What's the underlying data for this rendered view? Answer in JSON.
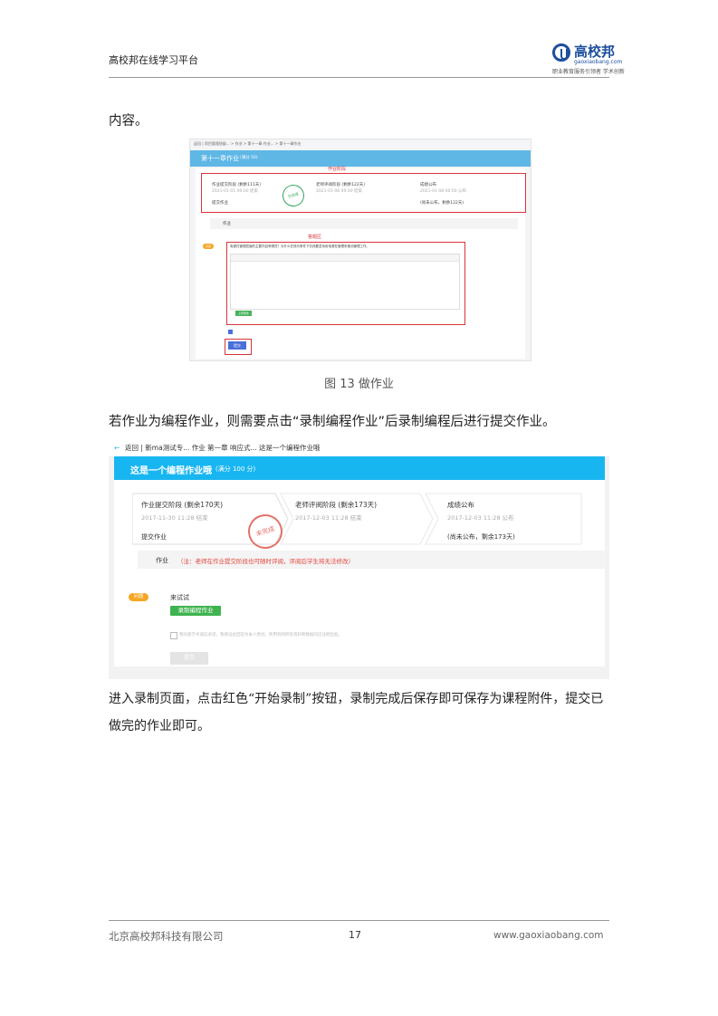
{
  "header": {
    "title": "高校邦在线学习平台",
    "logo_name": "高校邦",
    "logo_url": "gaoxiaobang.com",
    "logo_tagline": "职业教育服务引领者 学术创新"
  },
  "body": {
    "intro": "内容。",
    "figure13_caption": "图 13 做作业",
    "para_programming": "若作业为编程作业，则需要点击“录制编程作业”后录制编程后进行提交作业。",
    "para_record_line1": "进入录制页面，点击红色“开始录制”按钮，录制完成后保存即可保存为课程附件，提交已",
    "para_record_line2": "做完的作业即可。"
  },
  "screenshot1": {
    "breadcrumb": "返回 | 项目管理班级... > 作业 > 第十一章 作业... > 第十一章作业",
    "bar_title": "第十一章作业",
    "bar_score": "(满分 50)",
    "stage_label": "作业阶段",
    "answer_label": "答题区",
    "stages": [
      {
        "title": "作业提交阶段 (剩余111天)",
        "date": "2021-01-01 00:00 结束",
        "foot": "提交作业"
      },
      {
        "title": "老师评阅阶段 (剩余122天)",
        "date": "2021-01-08 00:00 结束",
        "foot": ""
      },
      {
        "title": "成绩公布",
        "date": "2021-01-08 00:00 公布",
        "foot": "(尚未公布，剩余122天)"
      }
    ],
    "stamp": "已完成",
    "work_label": "作业",
    "tag": "问题",
    "question": "电源在管理层面的主要内容有哪些？为什么在现代条件下仍然要坚持用电源在管理来推动管理工作。",
    "green_btn": "上传附件",
    "submit": "提交"
  },
  "screenshot2": {
    "breadcrumb": "返回  |  新ma测试专... 作业 第一章 响应式... 这是一个编程作业哦",
    "bar_title": "这是一个编程作业哦",
    "bar_score": "(满分 100 分)",
    "stages": [
      {
        "title": "作业提交阶段 (剩余170天)",
        "date": "2017-11-30 11:28 结束",
        "foot": "提交作业"
      },
      {
        "title": "老师评阅阶段 (剩余173天)",
        "date": "2017-12-03 11:28 结束",
        "foot": ""
      },
      {
        "title": "成绩公布",
        "date": "2017-12-03 11:28 公布",
        "foot": "(尚未公布，剩余173天)"
      }
    ],
    "stamp": "未完成",
    "work_label": "作业",
    "work_note": "（注：老师在作业提交阶段也可随时评阅，评阅后学生将无法修改）",
    "tag": "问题",
    "question": "来试试",
    "record_btn": "录制编程作业",
    "checkbox_text": "我同意学术诚信承诺，我保证此回答为本人原创，所用到的所有资料和数据均已注明出处。",
    "submit": "提交"
  },
  "footer": {
    "company": "北京高校邦科技有限公司",
    "page": "17",
    "website": "www.gaoxiaobang.com"
  },
  "colors": {
    "accent_blue": "#18b6f0",
    "brand": "#1c4f9c",
    "red_box": "#d9333a",
    "green": "#3fb34f"
  }
}
